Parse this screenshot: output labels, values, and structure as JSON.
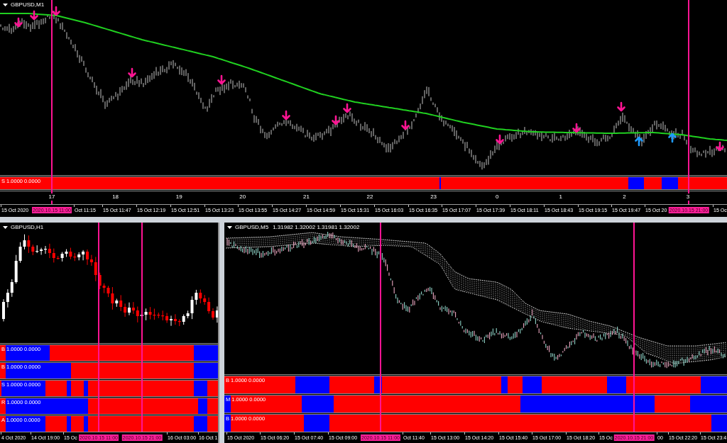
{
  "top_chart": {
    "title": "GBPUSD,M1",
    "indicator": {
      "label": "S 1.0000 0.0000"
    },
    "hour_labels": [
      "17",
      "18",
      "19",
      "20",
      "21",
      "22",
      "23",
      "0",
      "1",
      "2",
      "3"
    ],
    "time_axis": [
      {
        "kind": "tick",
        "text": "15 Oct 2020"
      },
      {
        "kind": "marker",
        "text": "2020.10.15 11:00"
      },
      {
        "kind": "tick",
        "text": "Oct 11:15"
      },
      {
        "kind": "tick",
        "text": "15 Oct 11:47"
      },
      {
        "kind": "tick",
        "text": "15 Oct 12:19"
      },
      {
        "kind": "tick",
        "text": "15 Oct 12:51"
      },
      {
        "kind": "tick",
        "text": "15 Oct 13:23"
      },
      {
        "kind": "tick",
        "text": "15 Oct 13:55"
      },
      {
        "kind": "tick",
        "text": "15 Oct 14:27"
      },
      {
        "kind": "tick",
        "text": "15 Oct 14:59"
      },
      {
        "kind": "tick",
        "text": "15 Oct 15:31"
      },
      {
        "kind": "tick",
        "text": "15 Oct 16:03"
      },
      {
        "kind": "tick",
        "text": "15 Oct 16:35"
      },
      {
        "kind": "tick",
        "text": "15 Oct 17:07"
      },
      {
        "kind": "tick",
        "text": "15 Oct 17:39"
      },
      {
        "kind": "tick",
        "text": "15 Oct 18:11"
      },
      {
        "kind": "tick",
        "text": "15 Oct 18:43"
      },
      {
        "kind": "tick",
        "text": "15 Oct 19:15"
      },
      {
        "kind": "tick",
        "text": "15 Oct 19:47"
      },
      {
        "kind": "tick",
        "text": "15 Oct 20"
      },
      {
        "kind": "marker",
        "text": "2020.10.15 21:00"
      },
      {
        "kind": "tick",
        "text": "15 Oc"
      }
    ]
  },
  "lower_left_chart": {
    "title": "GBPUSD,H1",
    "indicators": [
      {
        "label": "B 1.0000 0.0000"
      },
      {
        "label": "B 1.0000 0.0000"
      },
      {
        "label": "S 1.0000 0.0000"
      },
      {
        "label": "R 1.0000 0.0000"
      },
      {
        "label": "A 1.0000 0.0000"
      }
    ],
    "time_axis": [
      {
        "kind": "tick",
        "text": "4 Oct 2020"
      },
      {
        "kind": "tick",
        "text": "14 Oct 19:00"
      },
      {
        "kind": "tick",
        "text": "15 Oc"
      },
      {
        "kind": "marker",
        "text": "2020.10.15 11:00"
      },
      {
        "kind": "marker",
        "text": "2020.10.15 21:00"
      },
      {
        "kind": "tick",
        "text": "16 Oct 03:00"
      },
      {
        "kind": "tick",
        "text": "16 Oct 1"
      }
    ]
  },
  "lower_right_chart": {
    "title": "GBPUSD,M5",
    "quote": "1.31982 1.32002 1.31981 1.32002",
    "indicators": [
      {
        "label": "B 1.0000 0.0000"
      },
      {
        "label": "M 1.0000 0.0000"
      },
      {
        "label": "B 1.0000 0.0000"
      }
    ],
    "time_axis": [
      {
        "kind": "tick",
        "text": "15 Oct 2020"
      },
      {
        "kind": "tick",
        "text": "15 Oct 06:20"
      },
      {
        "kind": "tick",
        "text": "15 Oct 07:40"
      },
      {
        "kind": "tick",
        "text": "15 Oct 09:00"
      },
      {
        "kind": "marker",
        "text": "2020.10.15 11:00"
      },
      {
        "kind": "tick",
        "text": "Oct 11:40"
      },
      {
        "kind": "tick",
        "text": "15 Oct 13:00"
      },
      {
        "kind": "tick",
        "text": "15 Oct 14:20"
      },
      {
        "kind": "tick",
        "text": "15 Oct 15:40"
      },
      {
        "kind": "tick",
        "text": "15 Oct 17:00"
      },
      {
        "kind": "tick",
        "text": "15 Oct 18:20"
      },
      {
        "kind": "tick",
        "text": "15 Oc"
      },
      {
        "kind": "marker",
        "text": "2020.10.15 21:00"
      },
      {
        "kind": "tick",
        "text": "00"
      },
      {
        "kind": "tick",
        "text": "15 Oct 22:20"
      },
      {
        "kind": "tick",
        "text": "15 Oct 23:4"
      }
    ]
  }
}
